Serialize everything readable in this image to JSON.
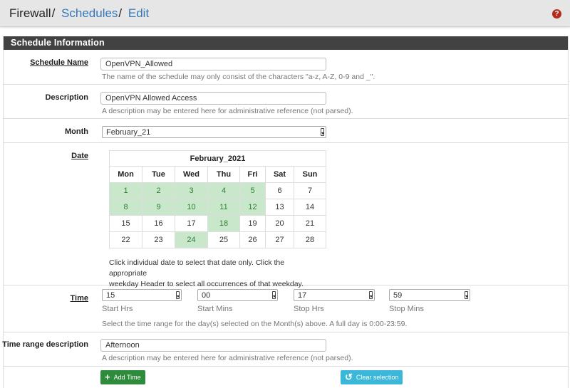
{
  "breadcrumb": {
    "root": "Firewall",
    "sep": "/",
    "schedules": "Schedules",
    "edit": "Edit"
  },
  "help_icon": "question-circle-icon",
  "panel_title": "Schedule Information",
  "schedule_name": {
    "label": "Schedule Name",
    "value": "OpenVPN_Allowed",
    "help": "The name of the schedule may only consist of the characters \"a-z, A-Z, 0-9 and _\"."
  },
  "description": {
    "label": "Description",
    "value": "OpenVPN Allowed Access",
    "help": "A description may be entered here for administrative reference (not parsed)."
  },
  "month": {
    "label": "Month",
    "value": "February_21"
  },
  "date": {
    "label": "Date",
    "calendar_title": "February_2021",
    "weekdays": [
      "Mon",
      "Tue",
      "Wed",
      "Thu",
      "Fri",
      "Sat",
      "Sun"
    ],
    "weeks": [
      [
        "1",
        "2",
        "3",
        "4",
        "5",
        "6",
        "7"
      ],
      [
        "8",
        "9",
        "10",
        "11",
        "12",
        "13",
        "14"
      ],
      [
        "15",
        "16",
        "17",
        "18",
        "19",
        "20",
        "21"
      ],
      [
        "22",
        "23",
        "24",
        "25",
        "26",
        "27",
        "28"
      ]
    ],
    "selected_days": [
      "1",
      "2",
      "3",
      "4",
      "5",
      "8",
      "9",
      "10",
      "11",
      "12",
      "18",
      "24"
    ],
    "help_line1": "Click individual date to select that date only. Click the appropriate",
    "help_line2": "weekday Header to select all occurrences of that weekday.",
    "selected_color": "#c9e8cb"
  },
  "time": {
    "label": "Time",
    "start_hrs": "15",
    "start_mins": "00",
    "stop_hrs": "17",
    "stop_mins": "59",
    "start_hrs_label": "Start Hrs",
    "start_mins_label": "Start Mins",
    "stop_hrs_label": "Stop Hrs",
    "stop_mins_label": "Stop Mins",
    "help": "Select the time range for the day(s) selected on the Month(s) above. A full day is 0:00-23:59."
  },
  "time_range_description": {
    "label": "Time range description",
    "value": "Afternoon",
    "help": "A description may be entered here for administrative reference (not parsed)."
  },
  "buttons": {
    "add_time": "Add Time",
    "add_time_icon": "plus-icon",
    "clear_selection": "Clear selection",
    "clear_selection_icon": "undo-icon"
  },
  "colors": {
    "link": "#3478b8",
    "panel_heading": "#424242",
    "add_button": "#2e8b3c",
    "clear_button": "#3bb8d9"
  }
}
